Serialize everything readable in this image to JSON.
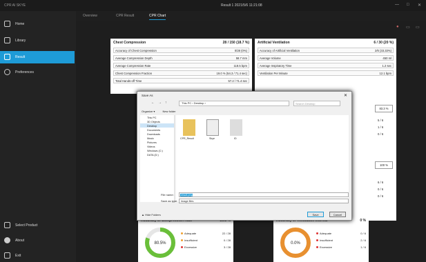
{
  "app": {
    "name": "CPR AI SKYE",
    "window_title": "Result 1 2021/5/6 11:21:08",
    "controls": [
      "—",
      "□",
      "✕"
    ]
  },
  "sidebar": {
    "items": [
      {
        "label": "Home",
        "icon": "home-icon"
      },
      {
        "label": "Library",
        "icon": "library-icon"
      },
      {
        "label": "Result",
        "icon": "result-icon"
      },
      {
        "label": "Preferences",
        "icon": "gear-icon"
      }
    ],
    "bottom": [
      {
        "label": "Select Product",
        "icon": "product-icon"
      },
      {
        "label": "About",
        "icon": "info-icon"
      },
      {
        "label": "Exit",
        "icon": "exit-icon"
      }
    ]
  },
  "tabs": [
    "Overview",
    "CPR Result",
    "CPR Chart"
  ],
  "chest": {
    "title": "Chest Compression",
    "value": "28 / 150 (18.7 %)",
    "rows": [
      {
        "k": "Accuracy of Chest Compression",
        "v": "0/28 (0%)"
      },
      {
        "k": "Average Compression Depth",
        "v": "58.7 mm"
      },
      {
        "k": "Average Compression Rate",
        "v": "118.5 bpm"
      },
      {
        "k": "Chest Compression Fraction",
        "v": "19.0 % (54.3 / 71.4 sec)"
      },
      {
        "k": "Total Hands-off Time",
        "v": "57.2 / 71.4 sec"
      }
    ]
  },
  "vent": {
    "title": "Artificial Ventilation",
    "value": "6 / 30 (20 %)",
    "rows": [
      {
        "k": "Accuracy of Artificial Ventilation",
        "v": "2/6 (33.33%)"
      },
      {
        "k": "Average Volume",
        "v": "450 ml"
      },
      {
        "k": "Average Inspiratory Time",
        "v": "1.2 sec"
      },
      {
        "k": "Ventilation Per Minute",
        "v": "12.1 bpm"
      }
    ]
  },
  "right_badges": [
    "83.3 %",
    "100 %"
  ],
  "right_stats": [
    "5 / 6",
    "1 / 6",
    "0 / 6",
    "6 / 6",
    "0 / 6",
    "0 / 6"
  ],
  "bottom_left": {
    "title": "Accuracy of Compression Rate",
    "value": "80.5 %",
    "center": "80.5%",
    "pct": 0.805,
    "legend": [
      {
        "name": "Adequate",
        "v": "22 / 28",
        "color": "#f0a030"
      },
      {
        "name": "Insufficient",
        "v": "0 / 28",
        "color": "#f0a030"
      },
      {
        "name": "Excessive",
        "v": "3 / 28",
        "color": "#d33"
      }
    ]
  },
  "bottom_right": {
    "title": "Accuracy of Ventilation Interval",
    "value": "0 %",
    "center": "0.0%",
    "pct": 0.0,
    "legend": [
      {
        "name": "Adequate",
        "v": "0 / 6",
        "color": "#d33"
      },
      {
        "name": "Insufficient",
        "v": "2 / 6",
        "color": "#d33"
      },
      {
        "name": "Excessive",
        "v": "1 / 6",
        "color": "#d33"
      }
    ]
  },
  "dialog": {
    "title": "Save As",
    "path": "This PC › Desktop ›",
    "search_placeholder": "Search Desktop",
    "organize": "Organize ▾",
    "new_folder": "New folder",
    "tree": [
      "This PC",
      "3D Objects",
      "Desktop",
      "Documents",
      "Downloads",
      "Music",
      "Pictures",
      "Videos",
      "Windows (C:)",
      "DATA (D:)"
    ],
    "files": [
      "CPR_Result",
      "Skye",
      "ID"
    ],
    "filename_label": "File name:",
    "filename_value": "result.png",
    "savetype_label": "Save as type:",
    "savetype_value": "Image files",
    "hide_folders": "▲ Hide Folders",
    "save": "Save",
    "cancel": "Cancel"
  }
}
